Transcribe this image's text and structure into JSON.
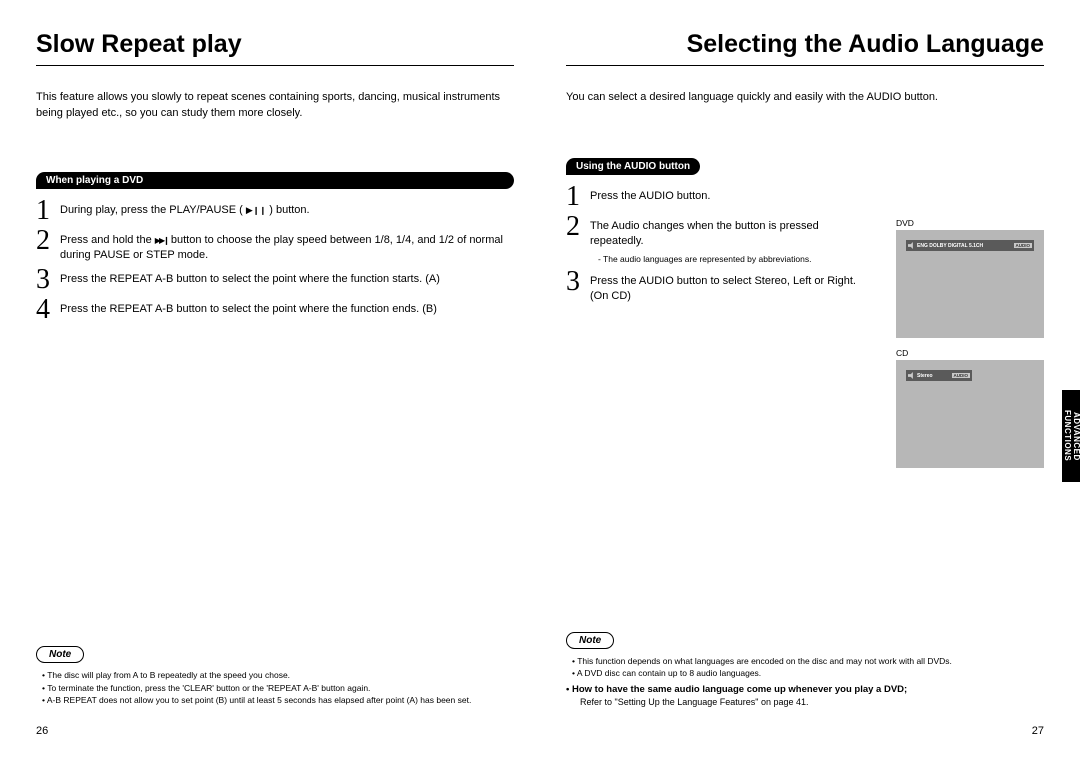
{
  "left": {
    "title": "Slow Repeat play",
    "intro": "This feature allows you slowly to repeat scenes containing sports, dancing, musical instruments being played etc., so you can study them more closely.",
    "section_label": "When playing a DVD",
    "steps": [
      {
        "n": "1",
        "text_before": "During play, press the PLAY/PAUSE ( ",
        "text_after": " ) button.",
        "icon": "play-pause"
      },
      {
        "n": "2",
        "text_before": "Press and hold the ",
        "text_after": " button to choose the play speed between 1/8, 1/4, and 1/2 of normal during PAUSE or STEP mode.",
        "icon": "skip"
      },
      {
        "n": "3",
        "text": "Press the REPEAT A-B button to select the point where the function starts. (A)"
      },
      {
        "n": "4",
        "text": "Press the REPEAT A-B button to select the point where the function ends. (B)"
      }
    ],
    "note_label": "Note",
    "notes": [
      "The disc will play from A to B repeatedly at the speed you chose.",
      "To terminate the function, press the 'CLEAR' button or the 'REPEAT A-B' button again.",
      "A-B REPEAT does not allow you to set point (B) until at least 5 seconds has elapsed after point (A) has been set."
    ],
    "page_num": "26"
  },
  "right": {
    "title": "Selecting the Audio Language",
    "intro": "You can select a desired language quickly and easily with the AUDIO button.",
    "section_label": "Using the AUDIO button",
    "steps": [
      {
        "n": "1",
        "text": "Press the AUDIO button."
      },
      {
        "n": "2",
        "text": "The Audio changes when the button is pressed repeatedly.",
        "subnote": "- The audio languages are represented by abbreviations."
      },
      {
        "n": "3",
        "text": "Press the AUDIO button to select Stereo, Left or Right. (On CD)"
      }
    ],
    "note_label": "Note",
    "notes": [
      "This function depends on what languages are encoded on the disc and may not work with all DVDs.",
      "A DVD disc can contain up to 8 audio languages."
    ],
    "note_bold": "• How to have the same audio language come up whenever you play a DVD;",
    "note_refer": "Refer to \"Setting Up the Language Features\" on page 41.",
    "page_num": "27",
    "fig1_label": "DVD",
    "fig1_bar": "ENG DOLBY DIGITAL 5.1CH",
    "fig1_badge": "AUDIO",
    "fig2_label": "CD",
    "fig2_bar": "Stereo",
    "fig2_badge": "AUDIO",
    "side_tab": "ADVANCED FUNCTIONS"
  }
}
